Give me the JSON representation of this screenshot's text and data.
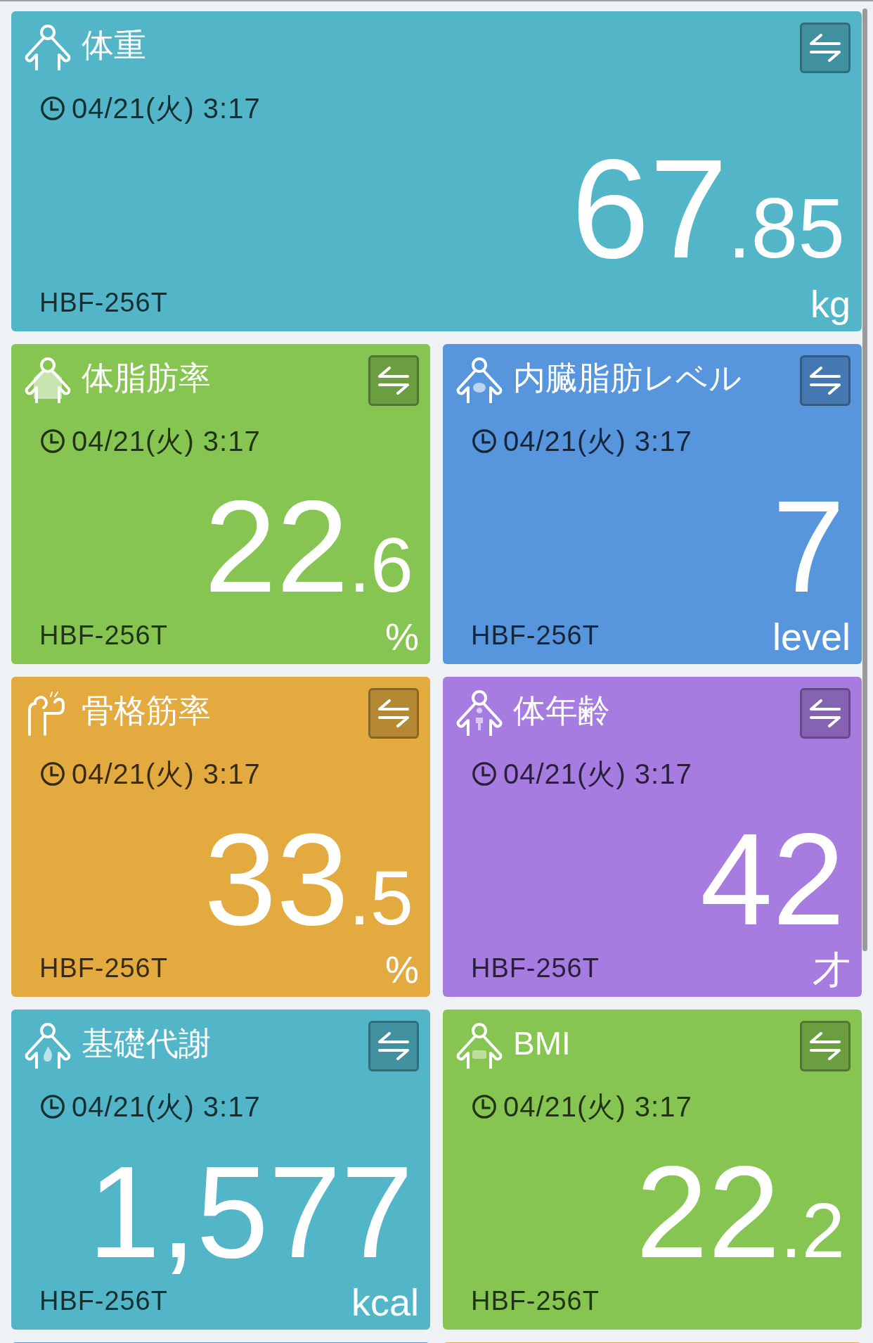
{
  "cards": [
    {
      "kind": "weight",
      "wide": true,
      "title": "体重",
      "time": "04/21(火) 3:17",
      "value": "67",
      "decimal": ".85",
      "unit": "kg",
      "model": "HBF-256T",
      "color": "#53b6c8"
    },
    {
      "kind": "body_fat",
      "wide": false,
      "title": "体脂肪率",
      "time": "04/21(火) 3:17",
      "value": "22",
      "decimal": ".6",
      "unit": "%",
      "model": "HBF-256T",
      "color": "#86c552"
    },
    {
      "kind": "visceral_fat",
      "wide": false,
      "title": "内臓脂肪レベル",
      "time": "04/21(火) 3:17",
      "value": "7",
      "unit": "level",
      "model": "HBF-256T",
      "color": "#5796dd"
    },
    {
      "kind": "muscle",
      "wide": false,
      "title": "骨格筋率",
      "time": "04/21(火) 3:17",
      "value": "33",
      "decimal": ".5",
      "unit": "%",
      "model": "HBF-256T",
      "color": "#e3aa40"
    },
    {
      "kind": "body_age",
      "wide": false,
      "title": "体年齢",
      "time": "04/21(火) 3:17",
      "value": "42",
      "unit": "才",
      "model": "HBF-256T",
      "color": "#a77ce0"
    },
    {
      "kind": "metabolism",
      "wide": false,
      "title": "基礎代謝",
      "time": "04/21(火) 3:17",
      "value": "1,577",
      "unit": "kcal",
      "model": "HBF-256T",
      "color": "#53b6c8"
    },
    {
      "kind": "bmi",
      "wide": false,
      "title": "BMI",
      "time": "04/21(火) 3:17",
      "value": "22",
      "decimal": ".2",
      "model": "HBF-256T",
      "color": "#86c552"
    }
  ],
  "more_cards": [
    {
      "color": "#5796dd"
    },
    {
      "color": "#e3aa40"
    }
  ]
}
